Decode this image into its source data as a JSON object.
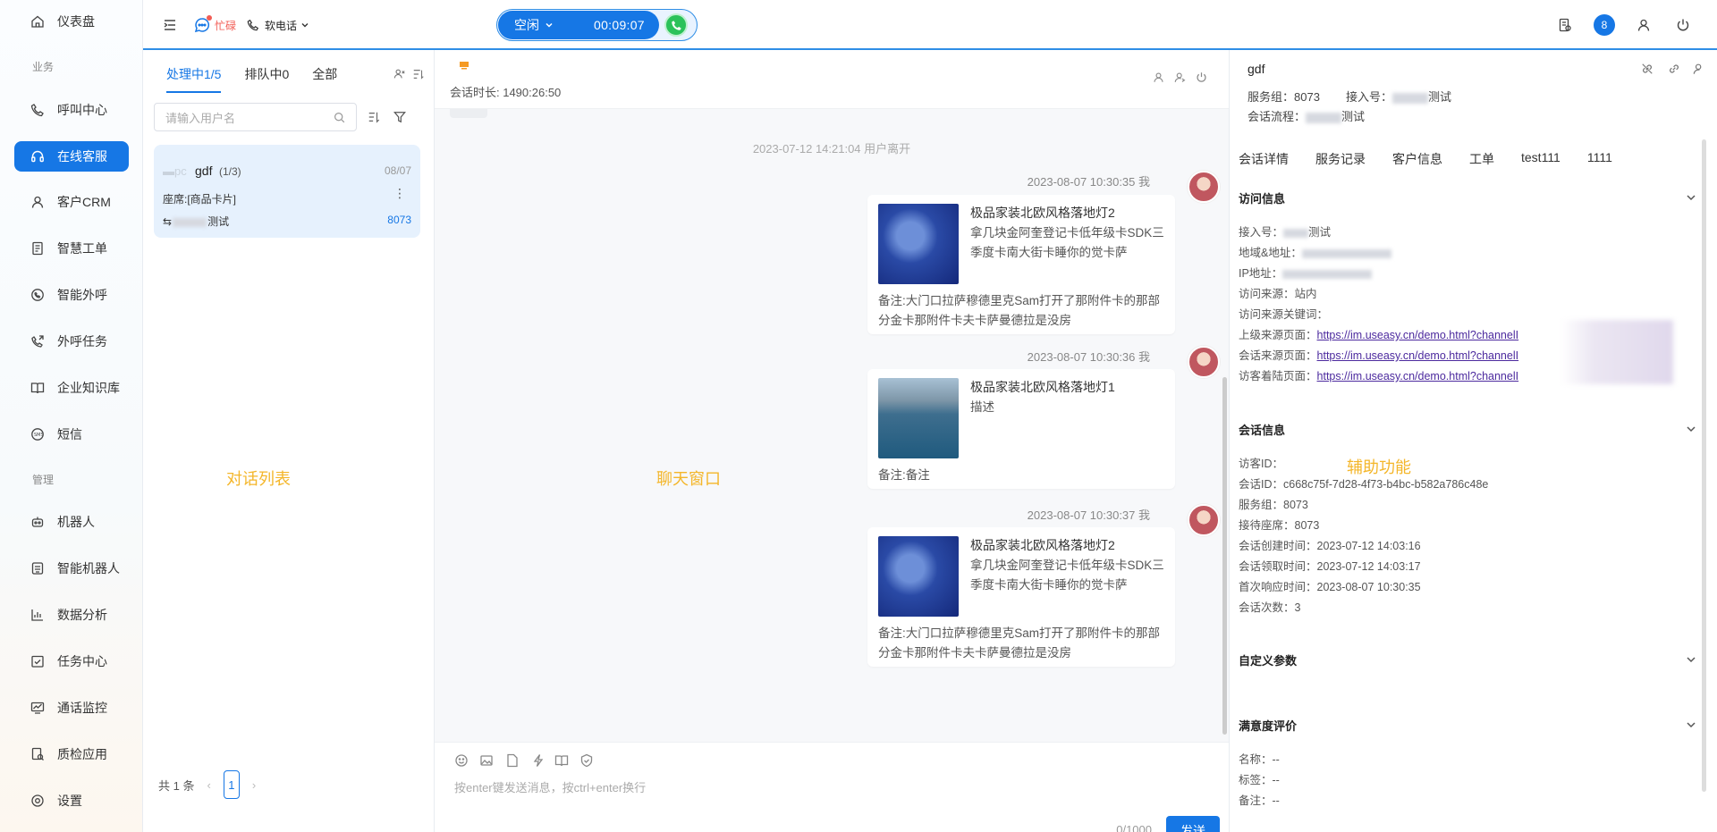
{
  "sidebar": {
    "items": [
      {
        "label": "仪表盘",
        "icon": "home-icon"
      },
      {
        "label": "呼叫中心",
        "icon": "phone-icon"
      },
      {
        "label": "在线客服",
        "icon": "headset-icon",
        "active": true
      },
      {
        "label": "客户CRM",
        "icon": "user-icon"
      },
      {
        "label": "智慧工单",
        "icon": "document-icon"
      },
      {
        "label": "智能外呼",
        "icon": "whatsapp-phone-icon"
      },
      {
        "label": "外呼任务",
        "icon": "phone-outgoing-icon"
      },
      {
        "label": "企业知识库",
        "icon": "book-icon"
      },
      {
        "label": "短信",
        "icon": "sms-icon"
      },
      {
        "label": "机器人",
        "icon": "robot-icon"
      },
      {
        "label": "智能机器人",
        "icon": "smart-robot-icon"
      },
      {
        "label": "数据分析",
        "icon": "bar-chart-icon"
      },
      {
        "label": "任务中心",
        "icon": "task-check-icon"
      },
      {
        "label": "通话监控",
        "icon": "monitor-icon"
      },
      {
        "label": "质检应用",
        "icon": "inspection-icon"
      },
      {
        "label": "设置",
        "icon": "settings-icon"
      }
    ],
    "sections": {
      "business": "业务",
      "manage": "管理"
    }
  },
  "topbar": {
    "busy_label": "忙碌",
    "softphone_label": "软电话",
    "status": "空闲",
    "timer": "00:09:07",
    "notification_count": "8"
  },
  "conversations": {
    "tabs": [
      "处理中1/5",
      "排队中0",
      "全部"
    ],
    "search_placeholder": "请输入用户名",
    "card": {
      "name": "gdf",
      "count": "(1/3)",
      "date": "08/07",
      "seat": "座席:[商品卡片]",
      "flow": "测试",
      "group": "8073"
    },
    "pager": {
      "total": "共 1 条",
      "page": "1"
    },
    "region_label": "对话列表"
  },
  "chat": {
    "duration": "会话时长: 1490:26:50",
    "system_msg": "2023-07-12 14:21:04 用户离开",
    "region_label": "聊天窗口",
    "messages": [
      {
        "time": "2023-08-07 10:30:35 我",
        "title": "极品家装北欧风格落地灯2",
        "desc": "拿几块金阿奎登记卡低年级卡SDK三季度卡南大街卡睡你的觉卡萨",
        "note": "备注:大门口拉萨穆德里克Sam打开了那附件卡的那部分金卡那附件卡夫卡萨曼德拉是没房"
      },
      {
        "time": "2023-08-07 10:30:36 我",
        "title": "极品家装北欧风格落地灯1",
        "desc": "描述",
        "note": "备注:备注"
      },
      {
        "time": "2023-08-07 10:30:37 我",
        "title": "极品家装北欧风格落地灯2",
        "desc": "拿几块金阿奎登记卡低年级卡SDK三季度卡南大街卡睡你的觉卡萨",
        "note": "备注:大门口拉萨穆德里克Sam打开了那附件卡的那部分金卡那附件卡夫卡萨曼德拉是没房"
      }
    ],
    "input_placeholder": "按enter键发送消息，按ctrl+enter换行",
    "char_count": "0/1000",
    "send_label": "发送"
  },
  "right": {
    "name": "gdf",
    "service_group": "服务组：8073",
    "access_no": "接入号：",
    "access_suffix": "测试",
    "flow": "会话流程：",
    "flow_suffix": "测试",
    "tabs": [
      "会话详情",
      "服务记录",
      "客户信息",
      "工单",
      "test111",
      "1111"
    ],
    "region_label": "辅助功能",
    "visit": {
      "title": "访问信息",
      "access": "接入号：",
      "access_suffix": "测试",
      "region": "地域&地址：",
      "ip": "IP地址：",
      "source": "访问来源：站内",
      "keyword": "访问来源关键词：",
      "upper_page_label": "上级来源页面：",
      "session_page_label": "会话来源页面：",
      "landing_page_label": "访客着陆页面：",
      "link": "https://im.useasy.cn/demo.html?channelI"
    },
    "session": {
      "title": "会话信息",
      "visitor_id": "访客ID：",
      "session_id": "会话ID：c668c75f-7d28-4f73-b4bc-b582a786c48e",
      "group": "服务组：8073",
      "seat": "接待座席：8073",
      "created": "会话创建时间：2023-07-12 14:03:16",
      "claimed": "会话领取时间：2023-07-12 14:03:17",
      "first_resp": "首次响应时间：2023-08-07 10:30:35",
      "times": "会话次数：3"
    },
    "custom_title": "自定义参数",
    "satisfaction": {
      "title": "满意度评价",
      "name": "名称：--",
      "tag": "标签：--",
      "note": "备注：--"
    }
  },
  "colors": {
    "primary": "#1677e5",
    "accent_label": "#f4b62a",
    "green": "#2bc25a",
    "busy": "#f25c54"
  }
}
